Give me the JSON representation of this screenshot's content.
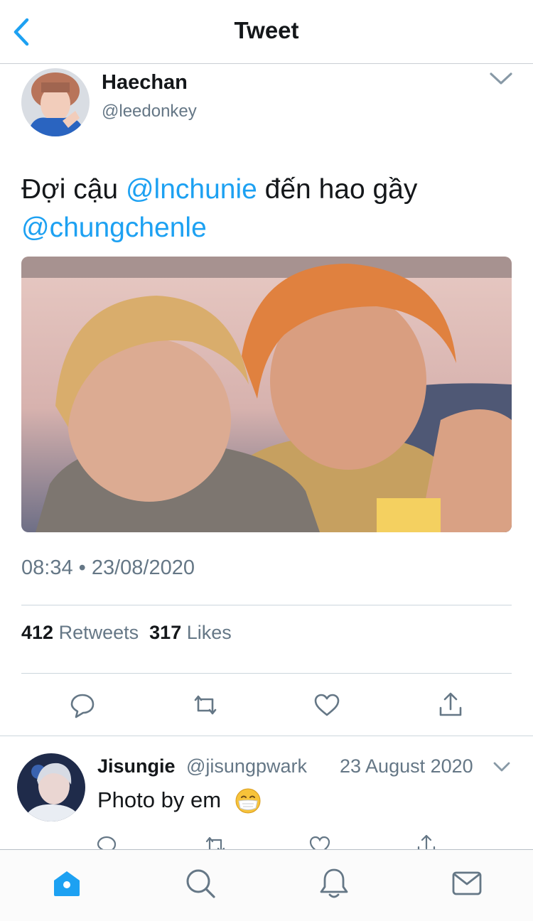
{
  "header": {
    "title": "Tweet",
    "back_icon": "chevron-left-icon"
  },
  "tweet": {
    "author_name": "Haechan",
    "author_handle": "@leedonkey",
    "text_part1": "Đợi cậu ",
    "mention1": "@lnchunie",
    "text_part2": " đến hao gầy",
    "mention2": "@chungchenle",
    "timestamp": "08:34 • 23/08/2020",
    "retweets_count": "412",
    "retweets_label": "Retweets",
    "likes_count": "317",
    "likes_label": "Likes"
  },
  "actions": [
    "reply-icon",
    "retweet-icon",
    "like-icon",
    "share-icon"
  ],
  "reply": {
    "author_name": "Jisungie",
    "author_handle": "@jisungpwark",
    "date": "23 August 2020",
    "text": "Photo by em",
    "emoji": "face-with-medical-mask"
  },
  "tabbar": [
    "home-icon",
    "search-icon",
    "notifications-icon",
    "messages-icon"
  ],
  "colors": {
    "accent": "#1da1f2",
    "secondary_text": "#657786",
    "primary_text": "#14171a",
    "divider": "#ccd6dd"
  }
}
